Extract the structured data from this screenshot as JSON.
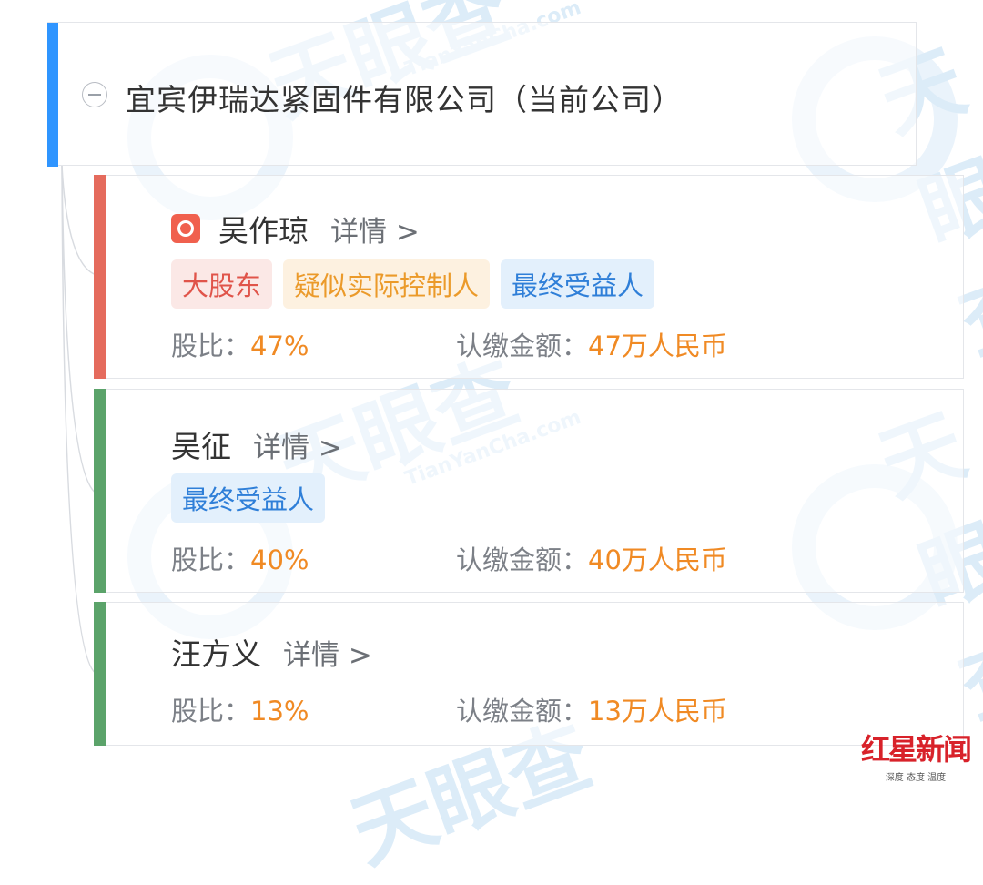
{
  "company": {
    "name": "宜宾伊瑞达紧固件有限公司（当前公司）"
  },
  "shareholders": [
    {
      "name": "吴作琼",
      "detail_label": "详情 >",
      "tags": [
        "大股东",
        "疑似实际控制人",
        "最终受益人"
      ],
      "share_label": "股比：",
      "share_value": "47%",
      "amount_label": "认缴金额：",
      "amount_value": "47万人民币"
    },
    {
      "name": "吴征",
      "detail_label": "详情 >",
      "tags": [
        "最终受益人"
      ],
      "share_label": "股比：",
      "share_value": "40%",
      "amount_label": "认缴金额：",
      "amount_value": "40万人民币"
    },
    {
      "name": "汪方义",
      "detail_label": "详情 >",
      "tags": [],
      "share_label": "股比：",
      "share_value": "13%",
      "amount_label": "认缴金额：",
      "amount_value": "13万人民币"
    }
  ],
  "watermark": {
    "brand": "天眼查",
    "url": "TianYanCha.com"
  },
  "logo": {
    "name": "红星新闻",
    "tagline": "深度 态度 温度"
  },
  "colors": {
    "company_accent": "#2f95ff",
    "major_accent": "#e56b5d",
    "other_accent": "#5ba36a",
    "value": "#f08a24"
  }
}
